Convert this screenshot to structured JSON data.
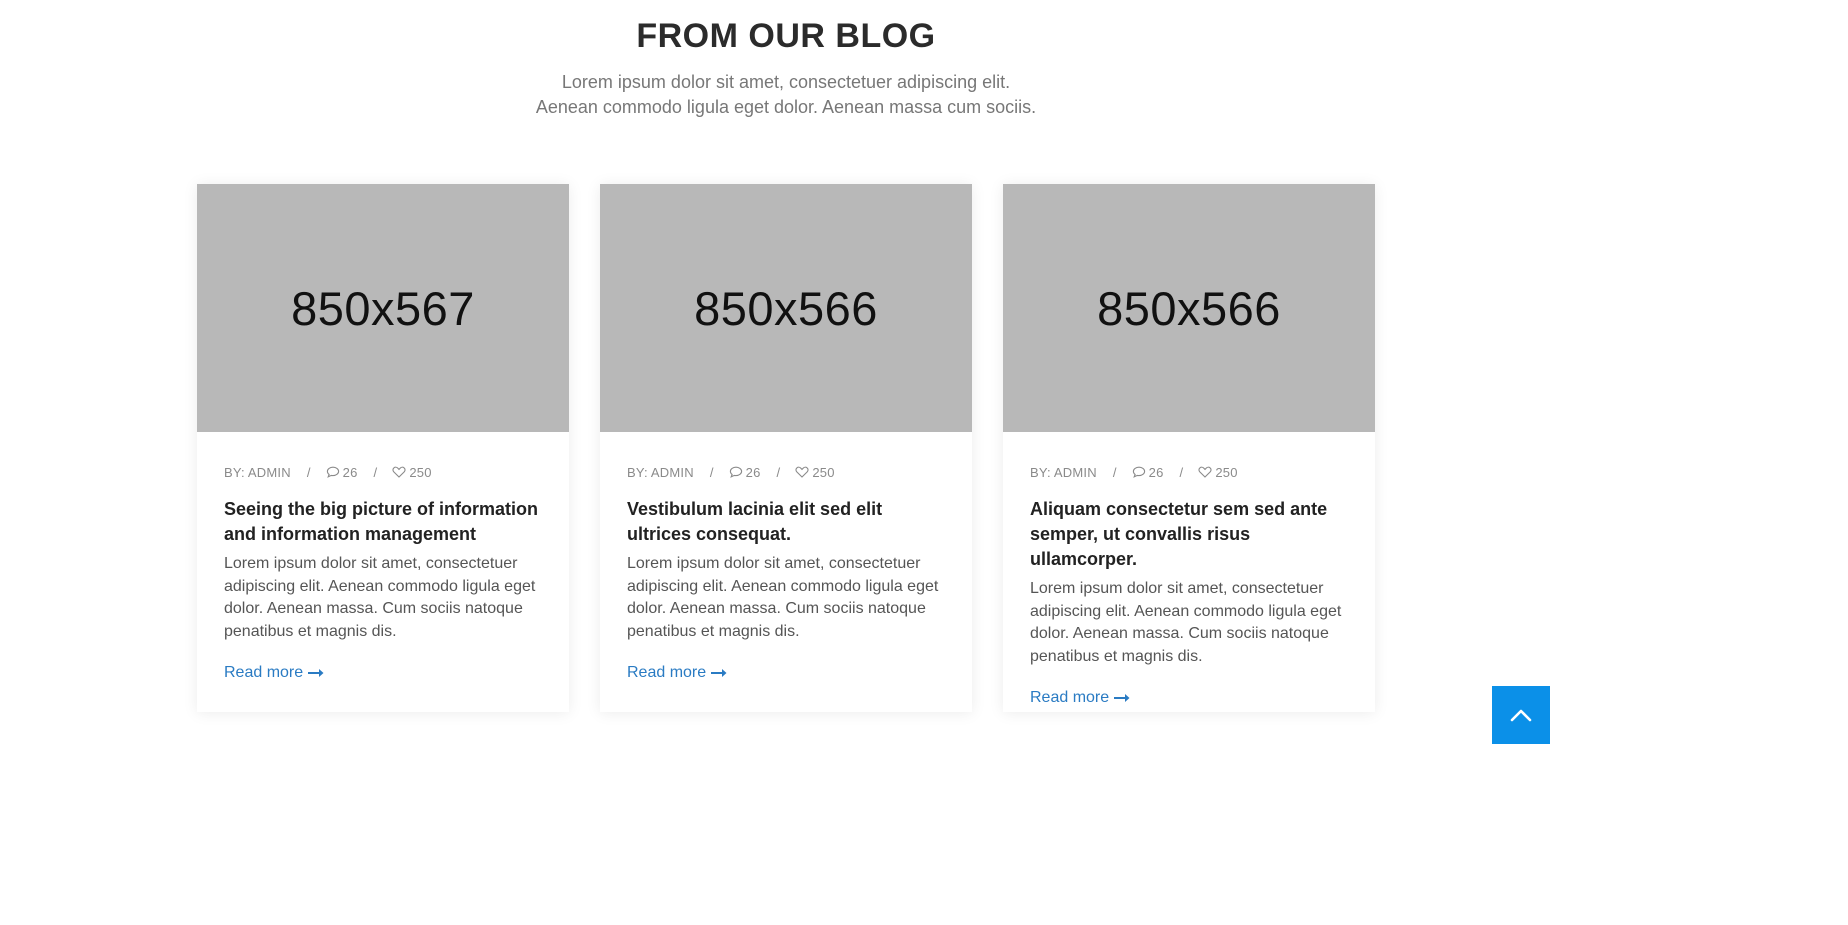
{
  "section": {
    "title": "FROM OUR BLOG",
    "subtitle": "Lorem ipsum dolor sit amet, consectetuer adipiscing elit. Aenean commodo ligula eget dolor. Aenean massa cum sociis."
  },
  "posts": [
    {
      "image_label": "850x567",
      "author": "BY: ADMIN",
      "comments": "26",
      "likes": "250",
      "title": "Seeing the big picture of information and information management",
      "excerpt": "Lorem ipsum dolor sit amet, consectetuer adipiscing elit. Aenean commodo ligula eget dolor. Aenean massa. Cum sociis natoque penatibus et magnis dis.",
      "read_more": "Read more"
    },
    {
      "image_label": "850x566",
      "author": "BY: ADMIN",
      "comments": "26",
      "likes": "250",
      "title": "Vestibulum lacinia elit sed elit ultrices consequat.",
      "excerpt": "Lorem ipsum dolor sit amet, consectetuer adipiscing elit. Aenean commodo ligula eget dolor. Aenean massa. Cum sociis natoque penatibus et magnis dis.",
      "read_more": "Read more"
    },
    {
      "image_label": "850x566",
      "author": "BY: ADMIN",
      "comments": "26",
      "likes": "250",
      "title": "Aliquam consectetur sem sed ante semper, ut convallis risus ullamcorper.",
      "excerpt": "Lorem ipsum dolor sit amet, consectetuer adipiscing elit. Aenean commodo ligula eget dolor. Aenean massa. Cum sociis natoque penatibus et magnis dis.",
      "read_more": "Read more"
    }
  ],
  "meta_separator": "/",
  "icons": {
    "comment": "comment-icon",
    "like": "heart-icon",
    "arrow": "arrow-right-icon",
    "back_to_top": "chevron-up-icon"
  },
  "colors": {
    "link": "#2a7bc3",
    "back_to_top_bg": "#0b90e8",
    "image_placeholder": "#b8b8b8"
  }
}
